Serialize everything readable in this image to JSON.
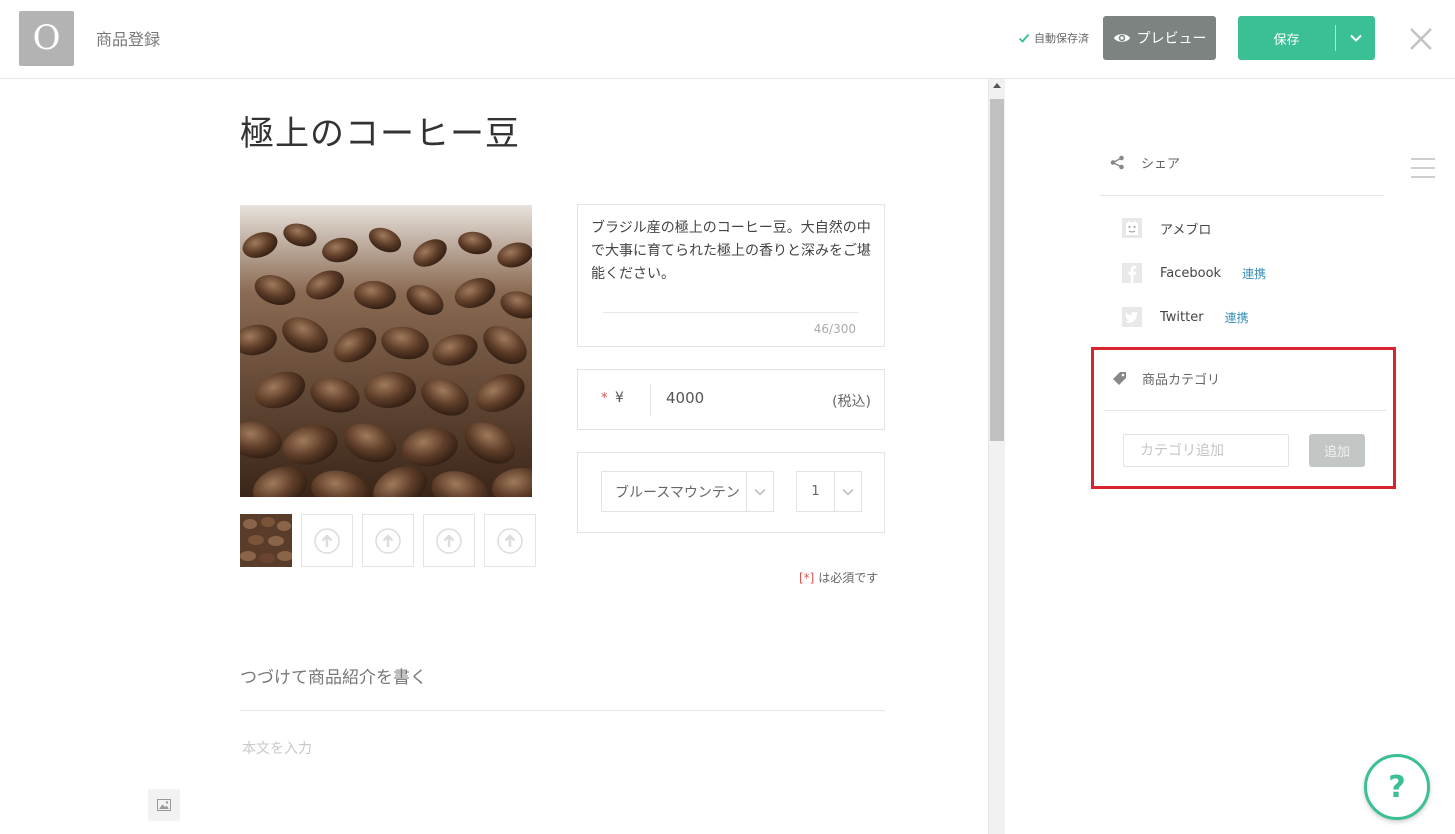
{
  "header": {
    "logo_letter": "O",
    "page_title": "商品登録",
    "autosave_status": "自動保存済",
    "preview_label": "プレビュー",
    "save_label": "保存"
  },
  "product": {
    "title": "極上のコーヒー豆",
    "description": "ブラジル産の極上のコーヒー豆。大自然の中で大事に育てられた極上の香りと深みをご堪能ください。",
    "description_count": "46/300",
    "price_required_mark": "*",
    "currency_symbol": "¥",
    "price": "4000",
    "tax_label": "(税込)",
    "variant_selected": "ブルースマウンテン",
    "quantity_selected": "1",
    "required_note_star": "[*]",
    "required_note_text": " は必須です"
  },
  "body_editor": {
    "continue_heading": "つづけて商品紹介を書く",
    "body_placeholder": "本文を入力"
  },
  "sidebar": {
    "share_title": "シェア",
    "socials": [
      {
        "name": "アメブロ",
        "link": ""
      },
      {
        "name": "Facebook",
        "link": "連携"
      },
      {
        "name": "Twitter",
        "link": "連携"
      }
    ],
    "category_title": "商品カテゴリ",
    "category_placeholder": "カテゴリ追加",
    "category_add_label": "追加"
  },
  "help_label": "?",
  "colors": {
    "brand_green": "#3bbf94",
    "preview_gray": "#7c8380",
    "highlight_red": "#d9232e",
    "link_blue": "#3a8fb7"
  }
}
